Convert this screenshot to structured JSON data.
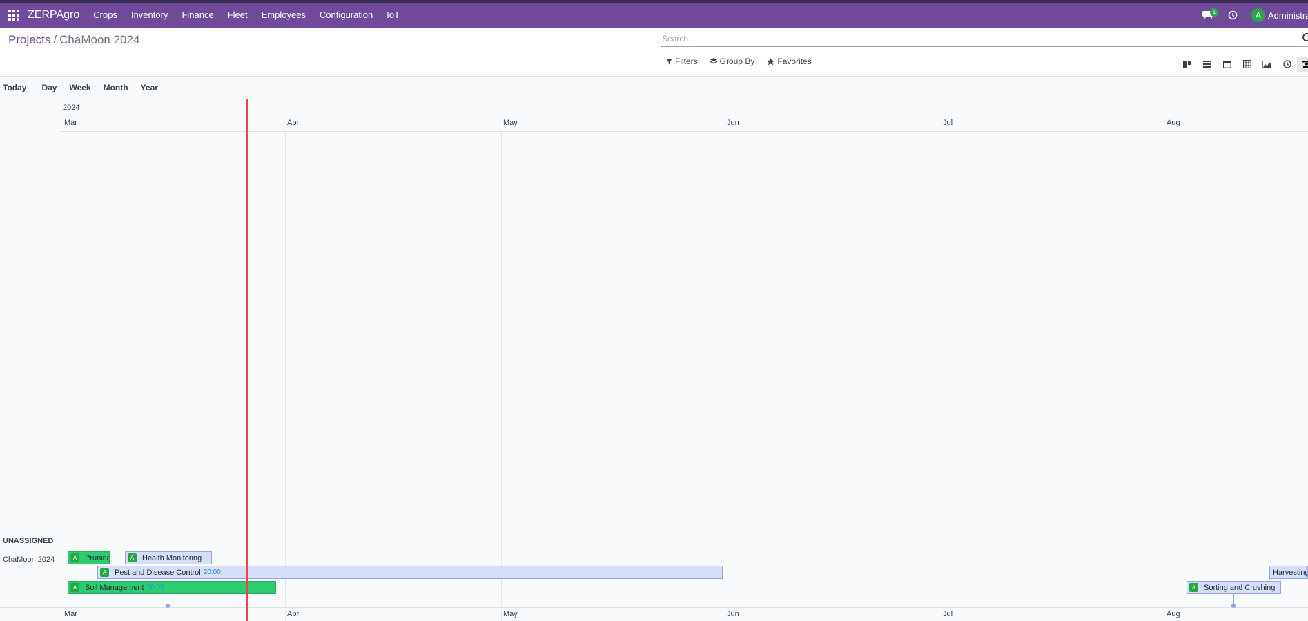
{
  "navbar": {
    "brand": "ZERPAgro",
    "menu": [
      "Crops",
      "Inventory",
      "Finance",
      "Fleet",
      "Employees",
      "Configuration",
      "IoT"
    ],
    "messages_count": "1",
    "user_initial": "A",
    "user_name": "Administrator"
  },
  "breadcrumb": {
    "parent": "Projects",
    "separator": "/",
    "current": "ChaMoon 2024"
  },
  "search": {
    "placeholder": "Search..."
  },
  "filters": {
    "filters_label": "Filters",
    "groupby_label": "Group By",
    "favorites_label": "Favorites"
  },
  "scales": {
    "today": "Today",
    "day": "Day",
    "week": "Week",
    "month": "Month",
    "year": "Year"
  },
  "gantt": {
    "year": "2024",
    "months": [
      "Mar",
      "Apr",
      "May",
      "Jun",
      "Jul",
      "Aug"
    ],
    "unassigned_label": "UNASSIGNED",
    "row_label": "ChaMoon 2024",
    "tasks": [
      {
        "name": "Pruning",
        "avatar": "A",
        "hours": ""
      },
      {
        "name": "Health Monitoring",
        "avatar": "A",
        "hours": ""
      },
      {
        "name": "Pest and Disease Control",
        "avatar": "A",
        "hours": "20:00"
      },
      {
        "name": "Soil Management",
        "avatar": "A",
        "hours": "50:00"
      },
      {
        "name": "Harvesting",
        "avatar": "",
        "hours": ""
      },
      {
        "name": "Sorting and Crushing",
        "avatar": "A",
        "hours": ""
      }
    ]
  },
  "colors": {
    "navbar": "#714b9b",
    "today_line": "#ef4444",
    "task_green": "#2ecc71",
    "task_blue": "#d6def8"
  }
}
